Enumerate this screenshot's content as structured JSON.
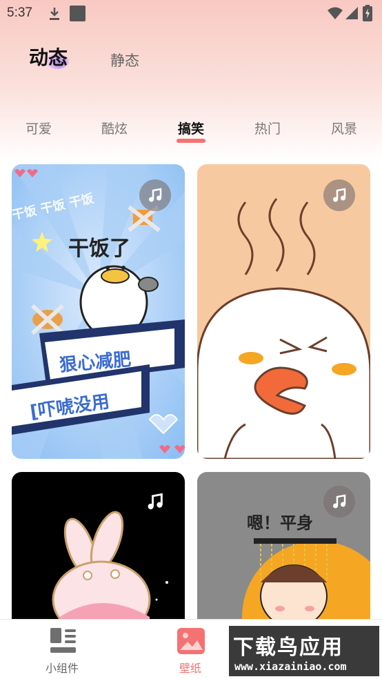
{
  "status": {
    "time": "5:37"
  },
  "mode_tabs": [
    {
      "label": "动态",
      "active": true
    },
    {
      "label": "静态",
      "active": false
    }
  ],
  "categories": [
    {
      "label": "可爱",
      "active": false
    },
    {
      "label": "酷炫",
      "active": false
    },
    {
      "label": "搞笑",
      "active": true
    },
    {
      "label": "热门",
      "active": false
    },
    {
      "label": "风景",
      "active": false
    }
  ],
  "cards": [
    {
      "text1": "干饭了",
      "text2": "狠心减肥",
      "text3": "[吓唬没用",
      "bg_text": "干饭 干饭 干饭",
      "icon": "music-note-icon"
    },
    {
      "icon": "music-note-icon"
    },
    {
      "icon": "music-note-icon"
    },
    {
      "caption": "嗯！平身",
      "icon": "music-note-icon"
    }
  ],
  "bottom_nav": [
    {
      "label": "小组件",
      "icon": "widget-icon",
      "active": false
    },
    {
      "label": "壁纸",
      "icon": "wallpaper-icon",
      "active": true
    }
  ],
  "watermark": {
    "title": "下载鸟应用",
    "url": "www.xiazainiao.com"
  },
  "colors": {
    "accent": "#f47272",
    "header": "#f8c9c2"
  }
}
